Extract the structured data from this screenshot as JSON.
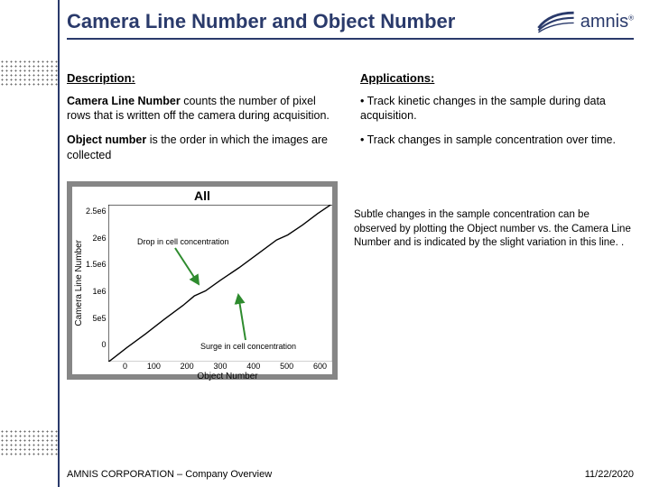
{
  "brand": {
    "name": "amnis",
    "reg": "®"
  },
  "title": "Camera Line Number and Object Number",
  "left": {
    "heading": "Description:",
    "p1_bold": "Camera Line Number",
    "p1_rest": " counts the number of pixel rows that is written off the camera during acquisition.",
    "p2_bold": "Object number",
    "p2_rest": " is the order in which the images are collected"
  },
  "right": {
    "heading": "Applications:",
    "b1": "• Track kinetic changes in the sample during data acquisition.",
    "b2": "• Track changes in sample concentration over time."
  },
  "annotations": {
    "drop": "Drop in cell concentration",
    "surge": "Surge in cell concentration"
  },
  "caption": "Subtle changes in the sample concentration can be observed by plotting the Object number vs. the Camera Line Number and is indicated by the slight variation in this line. .",
  "footer": {
    "left": "AMNIS CORPORATION – Company Overview",
    "right": "11/22/2020"
  },
  "chart_data": {
    "type": "line",
    "title": "All",
    "xlabel": "Object Number",
    "ylabel": "Camera Line Number",
    "xlim": [
      0,
      600
    ],
    "ylim": [
      0,
      2500000
    ],
    "yticks_labels": [
      "2.5e6",
      "2e6",
      "1.5e6",
      "1e6",
      "5e5",
      "0"
    ],
    "xticks_labels": [
      "0",
      "100",
      "200",
      "300",
      "400",
      "500",
      "600"
    ],
    "series": [
      {
        "name": "Camera Line Number",
        "x": [
          0,
          50,
          100,
          150,
          200,
          230,
          260,
          300,
          350,
          400,
          450,
          480,
          520,
          560,
          600
        ],
        "values": [
          0,
          230000,
          450000,
          680000,
          900000,
          1050000,
          1130000,
          1300000,
          1500000,
          1720000,
          1940000,
          2020000,
          2180000,
          2360000,
          2520000
        ]
      }
    ]
  }
}
